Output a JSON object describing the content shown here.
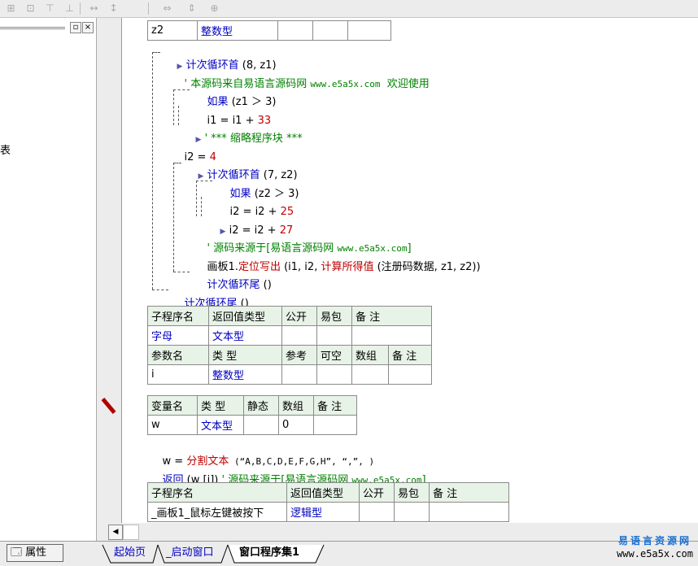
{
  "toolbar": {
    "icons": [
      "align-left-icon",
      "align-center-icon",
      "align-top-icon",
      "align-middle-icon",
      "equal-width-icon",
      "equal-height-icon",
      "same-width-icon",
      "same-height-icon",
      "same-size-icon"
    ]
  },
  "left_panel": {
    "min_btn": "▫",
    "close_btn": "×",
    "partial_text": "表"
  },
  "code": {
    "top_row": {
      "name": "z2",
      "type": "整数型"
    },
    "l1_kw": "计次循环首",
    "l1_args": "(8, z1)",
    "l2_comment": "' 本源码来自易语言源码网",
    "l2_url": "www.e5a5x.com",
    "l2_tail": "欢迎使用",
    "l3_kw": "如果",
    "l3_args": "(z1 ＞ 3)",
    "l4_a": "i1 = i1 + ",
    "l4_num": "33",
    "l5_comment": "' *** 缩略程序块 ***",
    "l6_a": "i2 = ",
    "l6_num": "4",
    "l7_kw": "计次循环首",
    "l7_args": "(7, z2)",
    "l8_kw": "如果",
    "l8_args": "(z2 ＞ 3)",
    "l9_a": "i2 = i2 + ",
    "l9_num": "25",
    "l10_a": "i2 = i2 + ",
    "l10_num": "27",
    "l11_comment": "' 源码来源于[易语言源码网",
    "l11_url": "www.e5a5x.com",
    "l11_tail": "]",
    "l12_obj": "画板1.",
    "l12_method": "定位写出",
    "l12_open": " (i1, i2, ",
    "l12_func": "计算所得值",
    "l12_rest": " (注册码数据, z1, z2))",
    "l13_kw": "计次循环尾",
    "l13_args": " ()",
    "l14_kw": "计次循环尾",
    "l14_args": " ()",
    "w_a": "w = ",
    "w_func": "分割文本",
    "w_args": " (“A,B,C,D,E,F,G,H”, “,”, )",
    "ret_kw": "返回",
    "ret_args": " (w [i]) ",
    "ret_comment": "' 源码来源于[易语言源码网",
    "ret_url": "www.e5a5x.com",
    "ret_tail": "]"
  },
  "sub_table": {
    "headers": [
      "子程序名",
      "返回值类型",
      "公开",
      "易包",
      "备 注"
    ],
    "row": [
      "字母",
      "文本型",
      "",
      "",
      ""
    ],
    "param_headers": [
      "参数名",
      "类 型",
      "参考",
      "可空",
      "数组",
      "备 注"
    ],
    "param_row": [
      "i",
      "整数型",
      "",
      "",
      "",
      ""
    ]
  },
  "var_table": {
    "headers": [
      "变量名",
      "类 型",
      "静态",
      "数组",
      "备 注"
    ],
    "row": [
      "w",
      "文本型",
      "",
      "0",
      ""
    ]
  },
  "sub_table2": {
    "headers": [
      "子程序名",
      "返回值类型",
      "公开",
      "易包",
      "备 注"
    ],
    "row": [
      "_画板1_鼠标左键被按下",
      "逻辑型",
      "",
      "",
      ""
    ]
  },
  "markers": {
    "folded": "≫",
    "current": "»"
  },
  "bottom": {
    "properties_label": "属性",
    "tabs": [
      "起始页",
      "_启动窗口",
      "窗口程序集1"
    ]
  },
  "watermark": {
    "cn": "易语言资源网",
    "url": "www.e5a5x.com"
  },
  "colors": {
    "comment": "#008000",
    "keyword": "#0000c0",
    "function": "#c00000"
  }
}
